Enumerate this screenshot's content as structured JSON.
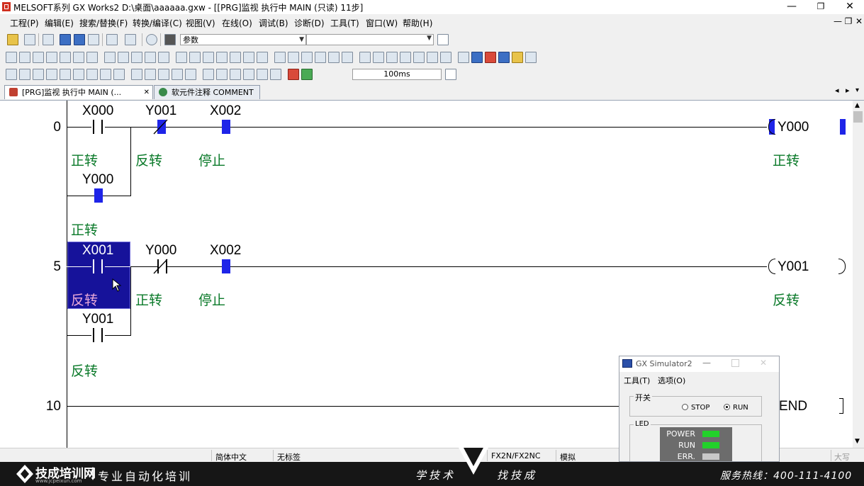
{
  "window": {
    "title": "MELSOFT系列 GX Works2 D:\\桌面\\aaaaaa.gxw - [[PRG]监视 执行中 MAIN (只读) 11步]",
    "minimize": "—",
    "restore": "❐",
    "close": "✕"
  },
  "menu": [
    "工程(P)",
    "编辑(E)",
    "搜索/替换(F)",
    "转换/编译(C)",
    "视图(V)",
    "在线(O)",
    "调试(B)",
    "诊断(D)",
    "工具(T)",
    "窗口(W)",
    "帮助(H)"
  ],
  "mdi_controls": [
    "—",
    "❐",
    "✕"
  ],
  "toolbar": {
    "param_combo": "参数",
    "scan_time": "100ms"
  },
  "tabs": [
    {
      "label": "[PRG]监视 执行中 MAIN (...",
      "close": "✕"
    },
    {
      "label": "软元件注释 COMMENT"
    }
  ],
  "tab_nav": {
    "prev": "◂",
    "next": "▸",
    "menu": "▾"
  },
  "ladder": {
    "steps": [
      "0",
      "5",
      "10"
    ],
    "rung0": {
      "contacts": [
        {
          "device": "X000",
          "comment": "正转"
        },
        {
          "device": "Y001",
          "comment": "反转"
        },
        {
          "device": "X002",
          "comment": "停止"
        }
      ],
      "parallel": {
        "device": "Y000",
        "comment": "正转"
      },
      "coil": {
        "device": "Y000",
        "comment": "正转"
      }
    },
    "rung5": {
      "contacts": [
        {
          "device": "X001",
          "comment": "反转"
        },
        {
          "device": "Y000",
          "comment": "正转"
        },
        {
          "device": "X002",
          "comment": "停止"
        }
      ],
      "parallel": {
        "device": "Y001",
        "comment": "反转"
      },
      "coil": {
        "device": "Y001",
        "comment": "反转"
      }
    },
    "end": "END"
  },
  "statusbar": {
    "language": "简体中文",
    "label": "无标签",
    "plc": "FX2N/FX2NC",
    "mode": "模拟",
    "caps": "大写"
  },
  "simulator": {
    "title": "GX Simulator2",
    "menu": [
      "工具(T)",
      "选项(O)"
    ],
    "switch_label": "开关",
    "stop": "STOP",
    "run": "RUN",
    "run_selected": true,
    "led_label": "LED",
    "leds": [
      {
        "name": "POWER",
        "color": "#22d12a"
      },
      {
        "name": "RUN",
        "color": "#22d12a"
      },
      {
        "name": "ERR.",
        "color": "#c8c8c8"
      }
    ]
  },
  "banner": {
    "logo": "技成培训网",
    "url": "www.jcpeixun.com",
    "slogan": "专业自动化培训",
    "left_text": "学技术",
    "right_text": "找技成",
    "hotline": "服务热线：400-111-4100"
  }
}
